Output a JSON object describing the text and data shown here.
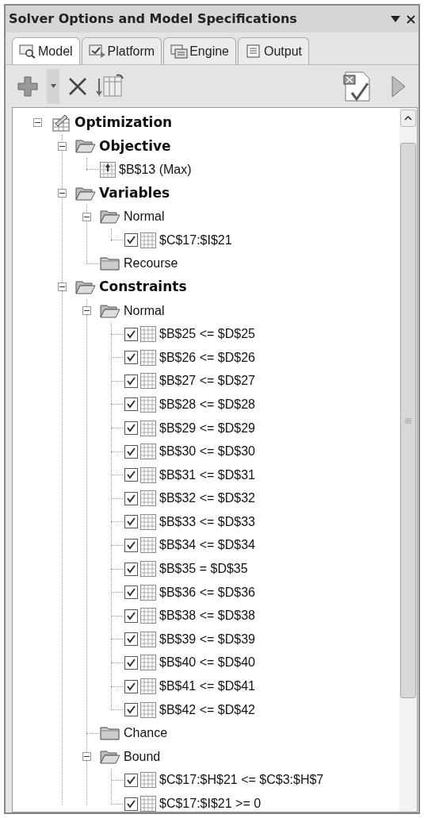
{
  "window": {
    "title": "Solver Options and Model Specifications"
  },
  "tabs": [
    {
      "label": "Model",
      "selected": true
    },
    {
      "label": "Platform",
      "selected": false
    },
    {
      "label": "Engine",
      "selected": false
    },
    {
      "label": "Output",
      "selected": false
    }
  ],
  "tree": [
    {
      "kind": "root",
      "label": "Optimization",
      "expanded": true,
      "children": [
        {
          "kind": "category",
          "label": "Objective",
          "expanded": true,
          "children": [
            {
              "kind": "objective",
              "label": "$B$13 (Max)"
            }
          ]
        },
        {
          "kind": "category",
          "label": "Variables",
          "expanded": true,
          "children": [
            {
              "kind": "folder",
              "label": "Normal",
              "expanded": true,
              "children": [
                {
                  "kind": "item",
                  "label": "$C$17:$I$21",
                  "checked": true
                }
              ]
            },
            {
              "kind": "folder",
              "label": "Recourse"
            }
          ]
        },
        {
          "kind": "category",
          "label": "Constraints",
          "expanded": true,
          "children": [
            {
              "kind": "folder",
              "label": "Normal",
              "expanded": true,
              "children": [
                {
                  "kind": "item",
                  "label": "$B$25 <= $D$25",
                  "checked": true
                },
                {
                  "kind": "item",
                  "label": "$B$26 <= $D$26",
                  "checked": true
                },
                {
                  "kind": "item",
                  "label": "$B$27 <= $D$27",
                  "checked": true
                },
                {
                  "kind": "item",
                  "label": "$B$28 <= $D$28",
                  "checked": true
                },
                {
                  "kind": "item",
                  "label": "$B$29 <= $D$29",
                  "checked": true
                },
                {
                  "kind": "item",
                  "label": "$B$30 <= $D$30",
                  "checked": true
                },
                {
                  "kind": "item",
                  "label": "$B$31 <= $D$31",
                  "checked": true
                },
                {
                  "kind": "item",
                  "label": "$B$32 <= $D$32",
                  "checked": true
                },
                {
                  "kind": "item",
                  "label": "$B$33 <= $D$33",
                  "checked": true
                },
                {
                  "kind": "item",
                  "label": "$B$34 <= $D$34",
                  "checked": true
                },
                {
                  "kind": "item",
                  "label": "$B$35 = $D$35",
                  "checked": true
                },
                {
                  "kind": "item",
                  "label": "$B$36 <= $D$36",
                  "checked": true
                },
                {
                  "kind": "item",
                  "label": "$B$38 <= $D$38",
                  "checked": true
                },
                {
                  "kind": "item",
                  "label": "$B$39 <= $D$39",
                  "checked": true
                },
                {
                  "kind": "item",
                  "label": "$B$40 <= $D$40",
                  "checked": true
                },
                {
                  "kind": "item",
                  "label": "$B$41 <= $D$41",
                  "checked": true
                },
                {
                  "kind": "item",
                  "label": "$B$42 <= $D$42",
                  "checked": true
                }
              ]
            },
            {
              "kind": "folder",
              "label": "Chance"
            },
            {
              "kind": "folder",
              "label": "Bound",
              "expanded": true,
              "children": [
                {
                  "kind": "item",
                  "label": "$C$17:$H$21 <= $C$3:$H$7",
                  "checked": true
                },
                {
                  "kind": "item",
                  "label": "$C$17:$I$21 >= 0",
                  "checked": true
                }
              ]
            }
          ]
        }
      ]
    }
  ]
}
